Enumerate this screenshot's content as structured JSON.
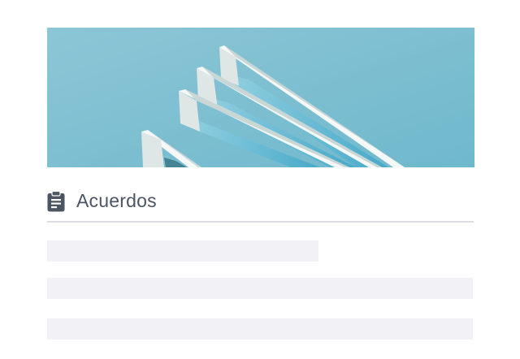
{
  "banner": {
    "image": "building-facade-sky-photo",
    "colors": {
      "sky": "#7fc0d2",
      "building": "#e8efee",
      "glass": "#5fb3cf"
    }
  },
  "section": {
    "icon": "clipboard-icon",
    "title": "Acuerdos",
    "title_color": "#4b5563",
    "divider_color": "#dcdee3"
  },
  "placeholders": {
    "count": 3,
    "color": "#f2f2f6"
  }
}
